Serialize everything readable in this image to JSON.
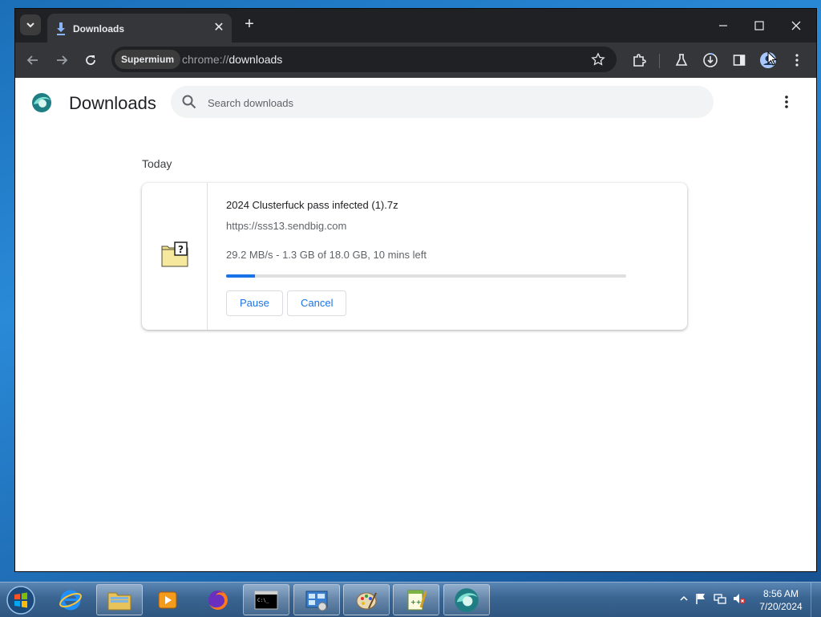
{
  "browser": {
    "tab_title": "Downloads",
    "profile_chip": "Supermium",
    "url_scheme": "chrome://",
    "url_path": "downloads",
    "accent": "#1a73e8"
  },
  "page": {
    "title": "Downloads",
    "search_placeholder": "Search downloads",
    "date_heading": "Today"
  },
  "download": {
    "file_name": "2024 Clusterfuck pass infected (1).7z",
    "url": "https://sss13.sendbig.com",
    "status": "29.2 MB/s - 1.3 GB of 18.0 GB, 10 mins left",
    "progress_fraction": 0.072,
    "pause_label": "Pause",
    "cancel_label": "Cancel"
  },
  "taskbar": {
    "apps": [
      "start-orb",
      "internet-explorer",
      "file-explorer",
      "media-player",
      "firefox",
      "command-prompt",
      "control-panel",
      "paint",
      "notepad-plus-plus",
      "supermium"
    ],
    "time": "8:56 AM",
    "date": "7/20/2024"
  }
}
